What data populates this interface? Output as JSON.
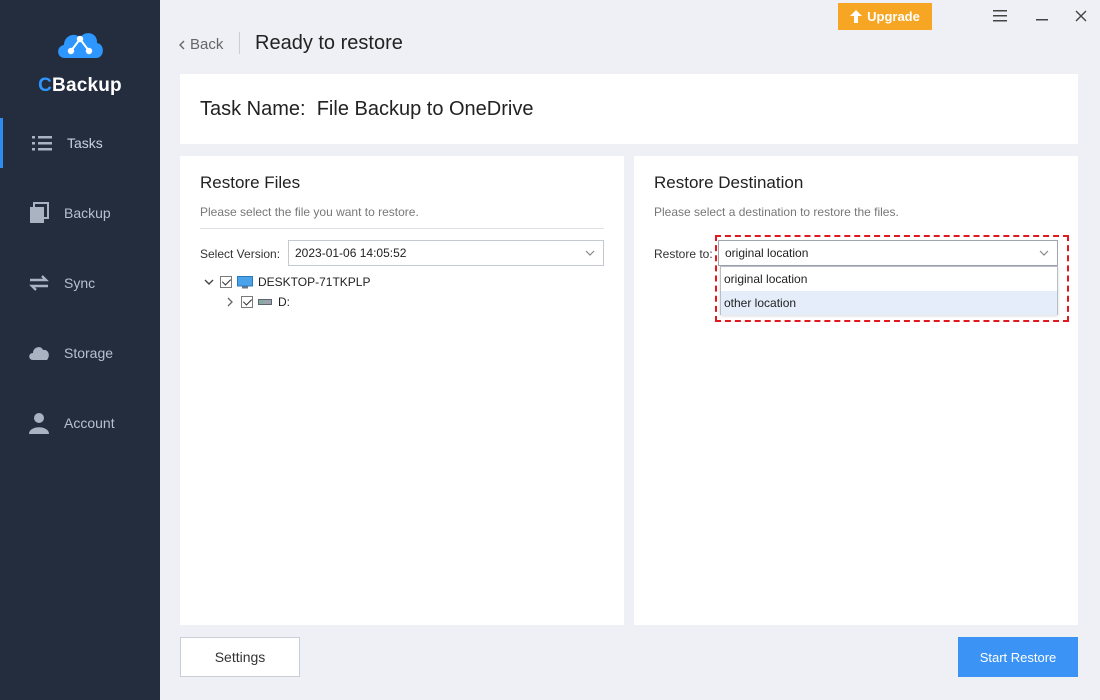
{
  "app": {
    "logo_c": "C",
    "logo_rest": "Backup"
  },
  "sidebar": {
    "items": [
      {
        "label": "Tasks",
        "icon": "list-icon",
        "active": true
      },
      {
        "label": "Backup",
        "icon": "backup-icon"
      },
      {
        "label": "Sync",
        "icon": "sync-icon"
      },
      {
        "label": "Storage",
        "icon": "cloud-icon"
      },
      {
        "label": "Account",
        "icon": "user-icon"
      }
    ]
  },
  "topbar": {
    "upgrade_label": "Upgrade",
    "minimize_label": "—",
    "close_label": "✕"
  },
  "header": {
    "back_label": "Back",
    "title": "Ready to restore"
  },
  "task": {
    "name_prefix": "Task Name:",
    "name": "File Backup to OneDrive"
  },
  "restore_files": {
    "heading": "Restore Files",
    "hint": "Please select the file you want to restore.",
    "version_label": "Select Version:",
    "version_value": "2023-01-06 14:05:52",
    "tree": [
      {
        "label": "DESKTOP-71TKPLP",
        "expanded": true,
        "checked": true
      },
      {
        "label": "D:",
        "expanded": false,
        "checked": true
      }
    ]
  },
  "restore_destination": {
    "heading": "Restore Destination",
    "hint": "Please select a destination to restore the files.",
    "restore_to_label": "Restore to:",
    "selected": "original location",
    "options": [
      "original location",
      "other location"
    ],
    "hovered_option": "other location"
  },
  "footer": {
    "settings_label": "Settings",
    "start_label": "Start Restore"
  },
  "colors": {
    "sidebar_bg": "#232d3e",
    "accent": "#2e8cf0",
    "upgrade": "#f6a623",
    "highlight": "#e0191f"
  }
}
